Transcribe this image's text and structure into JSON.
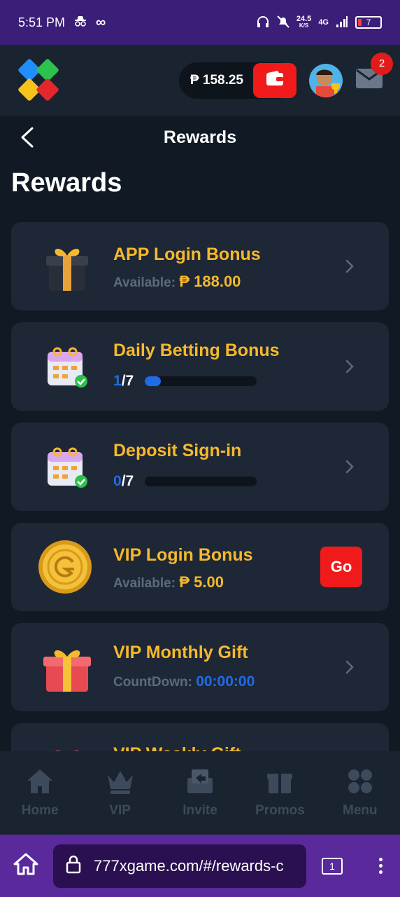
{
  "status_bar": {
    "time": "5:51 PM",
    "net_speed": "24.5",
    "net_unit": "K/S",
    "network": "4G",
    "battery": "7"
  },
  "header": {
    "currency": "₱",
    "balance": "158.25",
    "mail_badge": "2"
  },
  "page": {
    "nav_title": "Rewards",
    "heading": "Rewards"
  },
  "rewards": [
    {
      "title": "APP Login Bonus",
      "sub_label": "Available:",
      "amount": "₱ 188.00",
      "action": "chevron"
    },
    {
      "title": "Daily Betting Bonus",
      "progress_done": "1",
      "progress_total": "/7",
      "progress_fraction": 0.14,
      "action": "chevron"
    },
    {
      "title": "Deposit Sign-in",
      "progress_done": "0",
      "progress_total": "/7",
      "progress_fraction": 0.0,
      "action": "chevron"
    },
    {
      "title": "VIP Login Bonus",
      "sub_label": "Available:",
      "amount": "₱ 5.00",
      "action_label": "Go"
    },
    {
      "title": "VIP Monthly Gift",
      "sub_label": "CountDown:",
      "countdown": "00:00:00",
      "action": "chevron"
    },
    {
      "title": "VIP Weekly Gift"
    }
  ],
  "bottom_nav": [
    {
      "label": "Home",
      "icon": "home-icon"
    },
    {
      "label": "VIP",
      "icon": "crown-icon"
    },
    {
      "label": "Invite",
      "icon": "invite-icon"
    },
    {
      "label": "Promos",
      "icon": "gift-icon"
    },
    {
      "label": "Menu",
      "icon": "menu-icon"
    }
  ],
  "browser": {
    "url": "777xgame.com/#/rewards-c",
    "tab_count": "1"
  },
  "colors": {
    "accent_gold": "#f6b92c",
    "accent_red": "#f01a1a",
    "accent_blue": "#1e6ce8",
    "card_bg": "#1e2735"
  }
}
